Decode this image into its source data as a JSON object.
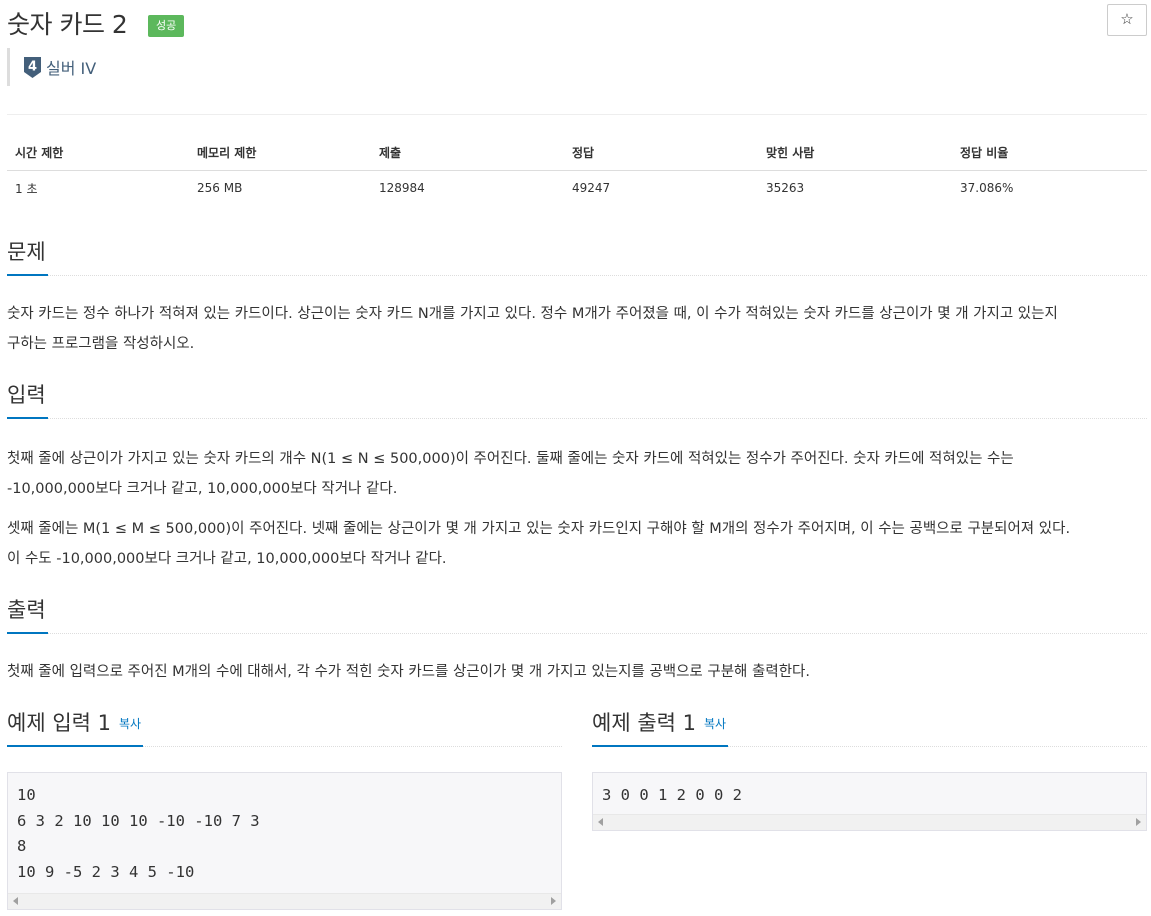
{
  "title": "숫자 카드 2",
  "result_badge": "성공",
  "star_icon": "☆",
  "tier": {
    "level": "4",
    "name": "실버 IV",
    "color": "#435f7a"
  },
  "info_table": {
    "headers": [
      "시간 제한",
      "메모리 제한",
      "제출",
      "정답",
      "맞힌 사람",
      "정답 비율"
    ],
    "values": [
      "1 초",
      "256 MB",
      "128984",
      "49247",
      "35263",
      "37.086%"
    ]
  },
  "problem": {
    "heading": "문제",
    "lines": [
      "숫자 카드는 정수 하나가 적혀져 있는 카드이다. 상근이는 숫자 카드 N개를 가지고 있다. 정수 M개가 주어졌을 때, 이 수가 적혀있는 숫자 카드를 상근이가 몇 개 가지고 있는지",
      "구하는 프로그램을 작성하시오."
    ]
  },
  "input": {
    "heading": "입력",
    "p1_lines": [
      "첫째 줄에 상근이가 가지고 있는 숫자 카드의 개수 N(1 ≤ N ≤ 500,000)이 주어진다. 둘째 줄에는 숫자 카드에 적혀있는 정수가 주어진다. 숫자 카드에 적혀있는 수는",
      "-10,000,000보다 크거나 같고, 10,000,000보다 작거나 같다."
    ],
    "p2_lines": [
      "셋째 줄에는 M(1 ≤ M ≤ 500,000)이 주어진다. 넷째 줄에는 상근이가 몇 개 가지고 있는 숫자 카드인지 구해야 할 M개의 정수가 주어지며, 이 수는 공백으로 구분되어져 있다.",
      "이 수도 -10,000,000보다 크거나 같고, 10,000,000보다 작거나 같다."
    ]
  },
  "output": {
    "heading": "출력",
    "text": "첫째 줄에 입력으로 주어진 M개의 수에 대해서, 각 수가 적힌 숫자 카드를 상근이가 몇 개 가지고 있는지를 공백으로 구분해 출력한다."
  },
  "sample_input": {
    "heading": "예제 입력 1",
    "copy_label": "복사",
    "text": "10\n6 3 2 10 10 10 -10 -10 7 3\n8\n10 9 -5 2 3 4 5 -10"
  },
  "sample_output": {
    "heading": "예제 출력 1",
    "copy_label": "복사",
    "text": "3 0 0 1 2 0 0 2"
  },
  "colors": {
    "accent": "#0076c0",
    "success": "#5cb85c"
  }
}
